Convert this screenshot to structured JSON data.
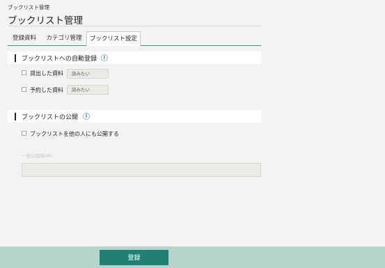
{
  "breadcrumb": "ブックリスト管理",
  "page_title": "ブックリスト管理",
  "tabs": [
    {
      "label": "登録資料"
    },
    {
      "label": "カテゴリ管理"
    },
    {
      "label": "ブックリスト設定"
    }
  ],
  "auto_register": {
    "title": "ブックリストへの自動登録",
    "info_icon": "i",
    "items": [
      {
        "label": "貸出した資料",
        "tag": "読みたい"
      },
      {
        "label": "予約した資料",
        "tag": "読みたい"
      }
    ]
  },
  "publish": {
    "title": "ブックリストの公開",
    "info_icon": "i",
    "checkbox_label": "ブックリストを他の人にも公開する",
    "url_label": "一般公開用URL",
    "url_value": ""
  },
  "footer": {
    "submit_label": "登録"
  },
  "colors": {
    "accent": "#217f74",
    "footer_bg": "#b6d3cc",
    "tab_rule": "#4f8b86"
  }
}
